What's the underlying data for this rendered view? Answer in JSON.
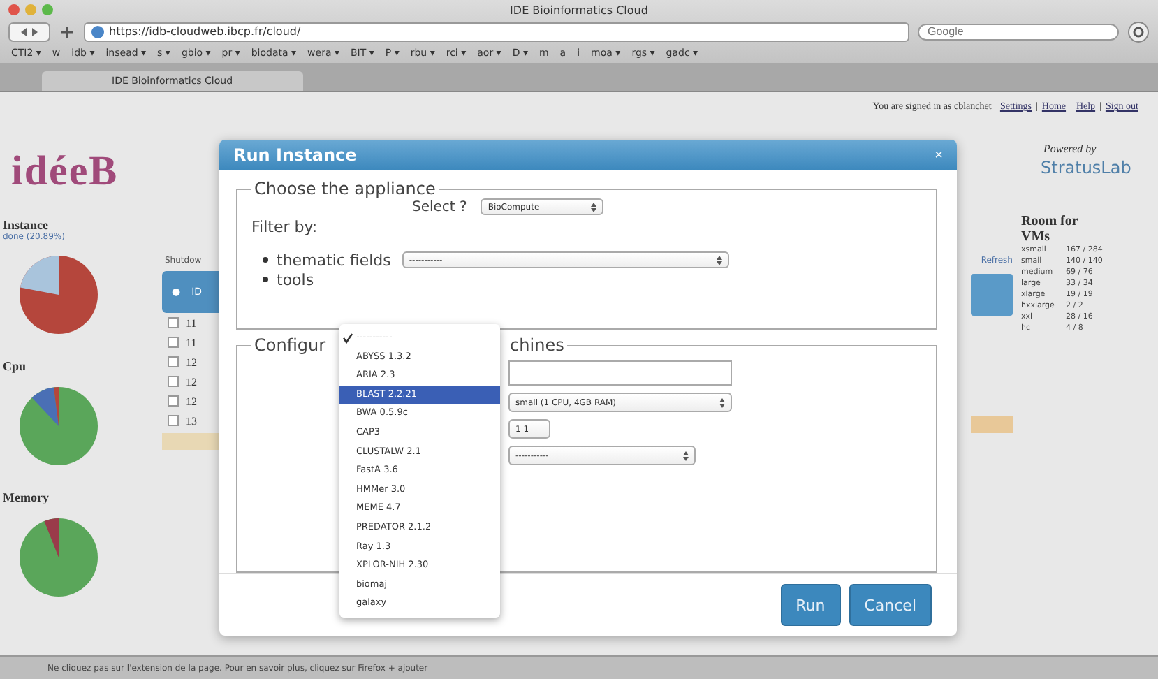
{
  "window": {
    "title": "IDE Bioinformatics Cloud"
  },
  "toolbar": {
    "url": "https://idb-cloudweb.ibcp.fr/cloud/",
    "search_placeholder": "Google"
  },
  "bookmarks": [
    "CTI2 ▾",
    "w",
    "idb ▾",
    "insead ▾",
    "s ▾",
    "gbio ▾",
    "pr ▾",
    "biodata ▾",
    "wera ▾",
    "BIT ▾",
    "P ▾",
    "rbu ▾",
    "rci ▾",
    "aor ▾",
    "D ▾",
    "m",
    "a",
    "i",
    "moa ▾",
    "rgs ▾",
    "gadc ▾"
  ],
  "tabs": [
    {
      "label": "IDE Bioinformatics Cloud",
      "selected": true
    }
  ],
  "header": {
    "signed_in": "You are signed in as cblanchet |",
    "links": [
      "Settings",
      "Home",
      "Help",
      "Sign out"
    ],
    "separator": "|"
  },
  "logo": {
    "text": "idéeB"
  },
  "stats": [
    {
      "title": "Instance",
      "subtitle": "done (20.89%)",
      "color": "#b5463c"
    },
    {
      "title": "Cpu",
      "color": "#5aa65a"
    },
    {
      "title": "Memory",
      "color": "#5aa65a"
    }
  ],
  "table": {
    "toolbar_label": "Shutdow",
    "header": [
      "●",
      "ID"
    ],
    "rows": [
      {
        "id": "11",
        "checked": false
      },
      {
        "id": "11",
        "checked": false
      },
      {
        "id": "12",
        "checked": false
      },
      {
        "id": "12",
        "checked": false
      },
      {
        "id": "12",
        "checked": false
      },
      {
        "id": "13",
        "checked": false
      }
    ],
    "refresh": "Refresh"
  },
  "powered": {
    "label": "Powered by",
    "brand": "StratusLab"
  },
  "room": {
    "title": "Room for VMs",
    "rows": [
      {
        "name": "xsmall",
        "value": "167 / 284"
      },
      {
        "name": "small",
        "value": "140 / 140"
      },
      {
        "name": "medium",
        "value": "69 / 76"
      },
      {
        "name": "large",
        "value": "33 / 34"
      },
      {
        "name": "xlarge",
        "value": "19 / 19"
      },
      {
        "name": "hxxlarge",
        "value": "2 / 2"
      },
      {
        "name": "xxl",
        "value": "28 / 16"
      },
      {
        "name": "hc",
        "value": "4 / 8"
      }
    ]
  },
  "dialog": {
    "title": "Run Instance",
    "close": "×",
    "appliance": {
      "legend": "Choose the appliance",
      "select_label": "Select ?",
      "select_value": "BioCompute",
      "filter_label": "Filter by:",
      "filters": [
        {
          "label": "thematic fields",
          "value": "-----------"
        },
        {
          "label": "tools"
        }
      ]
    },
    "config": {
      "legend_parts": [
        "Configur",
        "chines"
      ],
      "size": "small (1 CPU, 4GB RAM)",
      "count": "1 1",
      "option": "-----------"
    },
    "buttons": [
      "Run",
      "Cancel"
    ],
    "dropdown": [
      {
        "label": "-----------",
        "selected": false,
        "checked": true
      },
      {
        "label": "ABYSS 1.3.2",
        "selected": false,
        "checked": false
      },
      {
        "label": "ARIA 2.3",
        "selected": false,
        "checked": false
      },
      {
        "label": "BLAST 2.2.21",
        "selected": true,
        "checked": false
      },
      {
        "label": "BWA 0.5.9c",
        "selected": false,
        "checked": false
      },
      {
        "label": "CAP3",
        "selected": false,
        "checked": false
      },
      {
        "label": "CLUSTALW 2.1",
        "selected": false,
        "checked": false
      },
      {
        "label": "FastA 3.6",
        "selected": false,
        "checked": false
      },
      {
        "label": "HMMer 3.0",
        "selected": false,
        "checked": false
      },
      {
        "label": "MEME 4.7",
        "selected": false,
        "checked": false
      },
      {
        "label": "PREDATOR 2.1.2",
        "selected": false,
        "checked": false
      },
      {
        "label": "Ray 1.3",
        "selected": false,
        "checked": false
      },
      {
        "label": "XPLOR-NIH 2.30",
        "selected": false,
        "checked": false
      },
      {
        "label": "biomaj",
        "selected": false,
        "checked": false
      },
      {
        "label": "galaxy",
        "selected": false,
        "checked": false
      }
    ]
  },
  "status_bar": "Ne cliquez pas sur l'extension de la page. Pour en savoir plus, cliquez sur Firefox + ajouter"
}
